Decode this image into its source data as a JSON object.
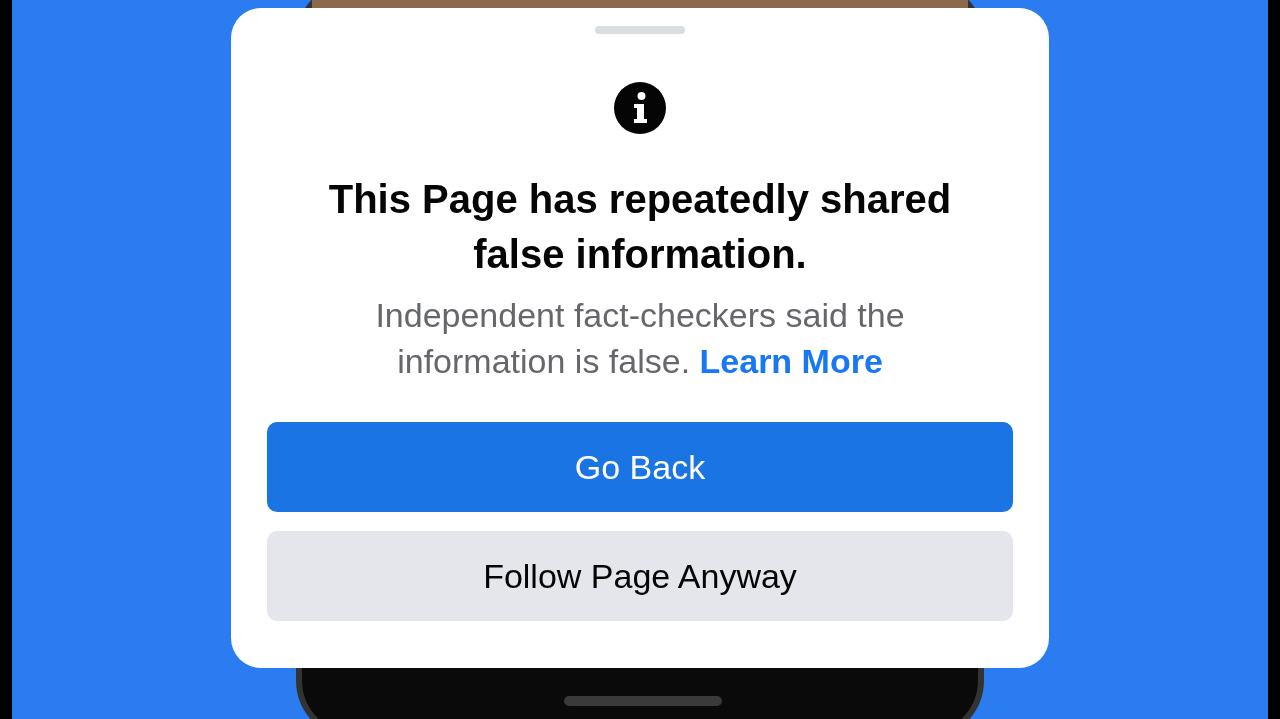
{
  "dialog": {
    "title": "This Page has repeatedly shared false information.",
    "body": "Independent fact-checkers said the information is false.",
    "link": "Learn More",
    "buttons": [
      {
        "label": "Go Back",
        "kind": "primary"
      },
      {
        "label": "Follow Page Anyway",
        "kind": "secondary"
      }
    ]
  }
}
